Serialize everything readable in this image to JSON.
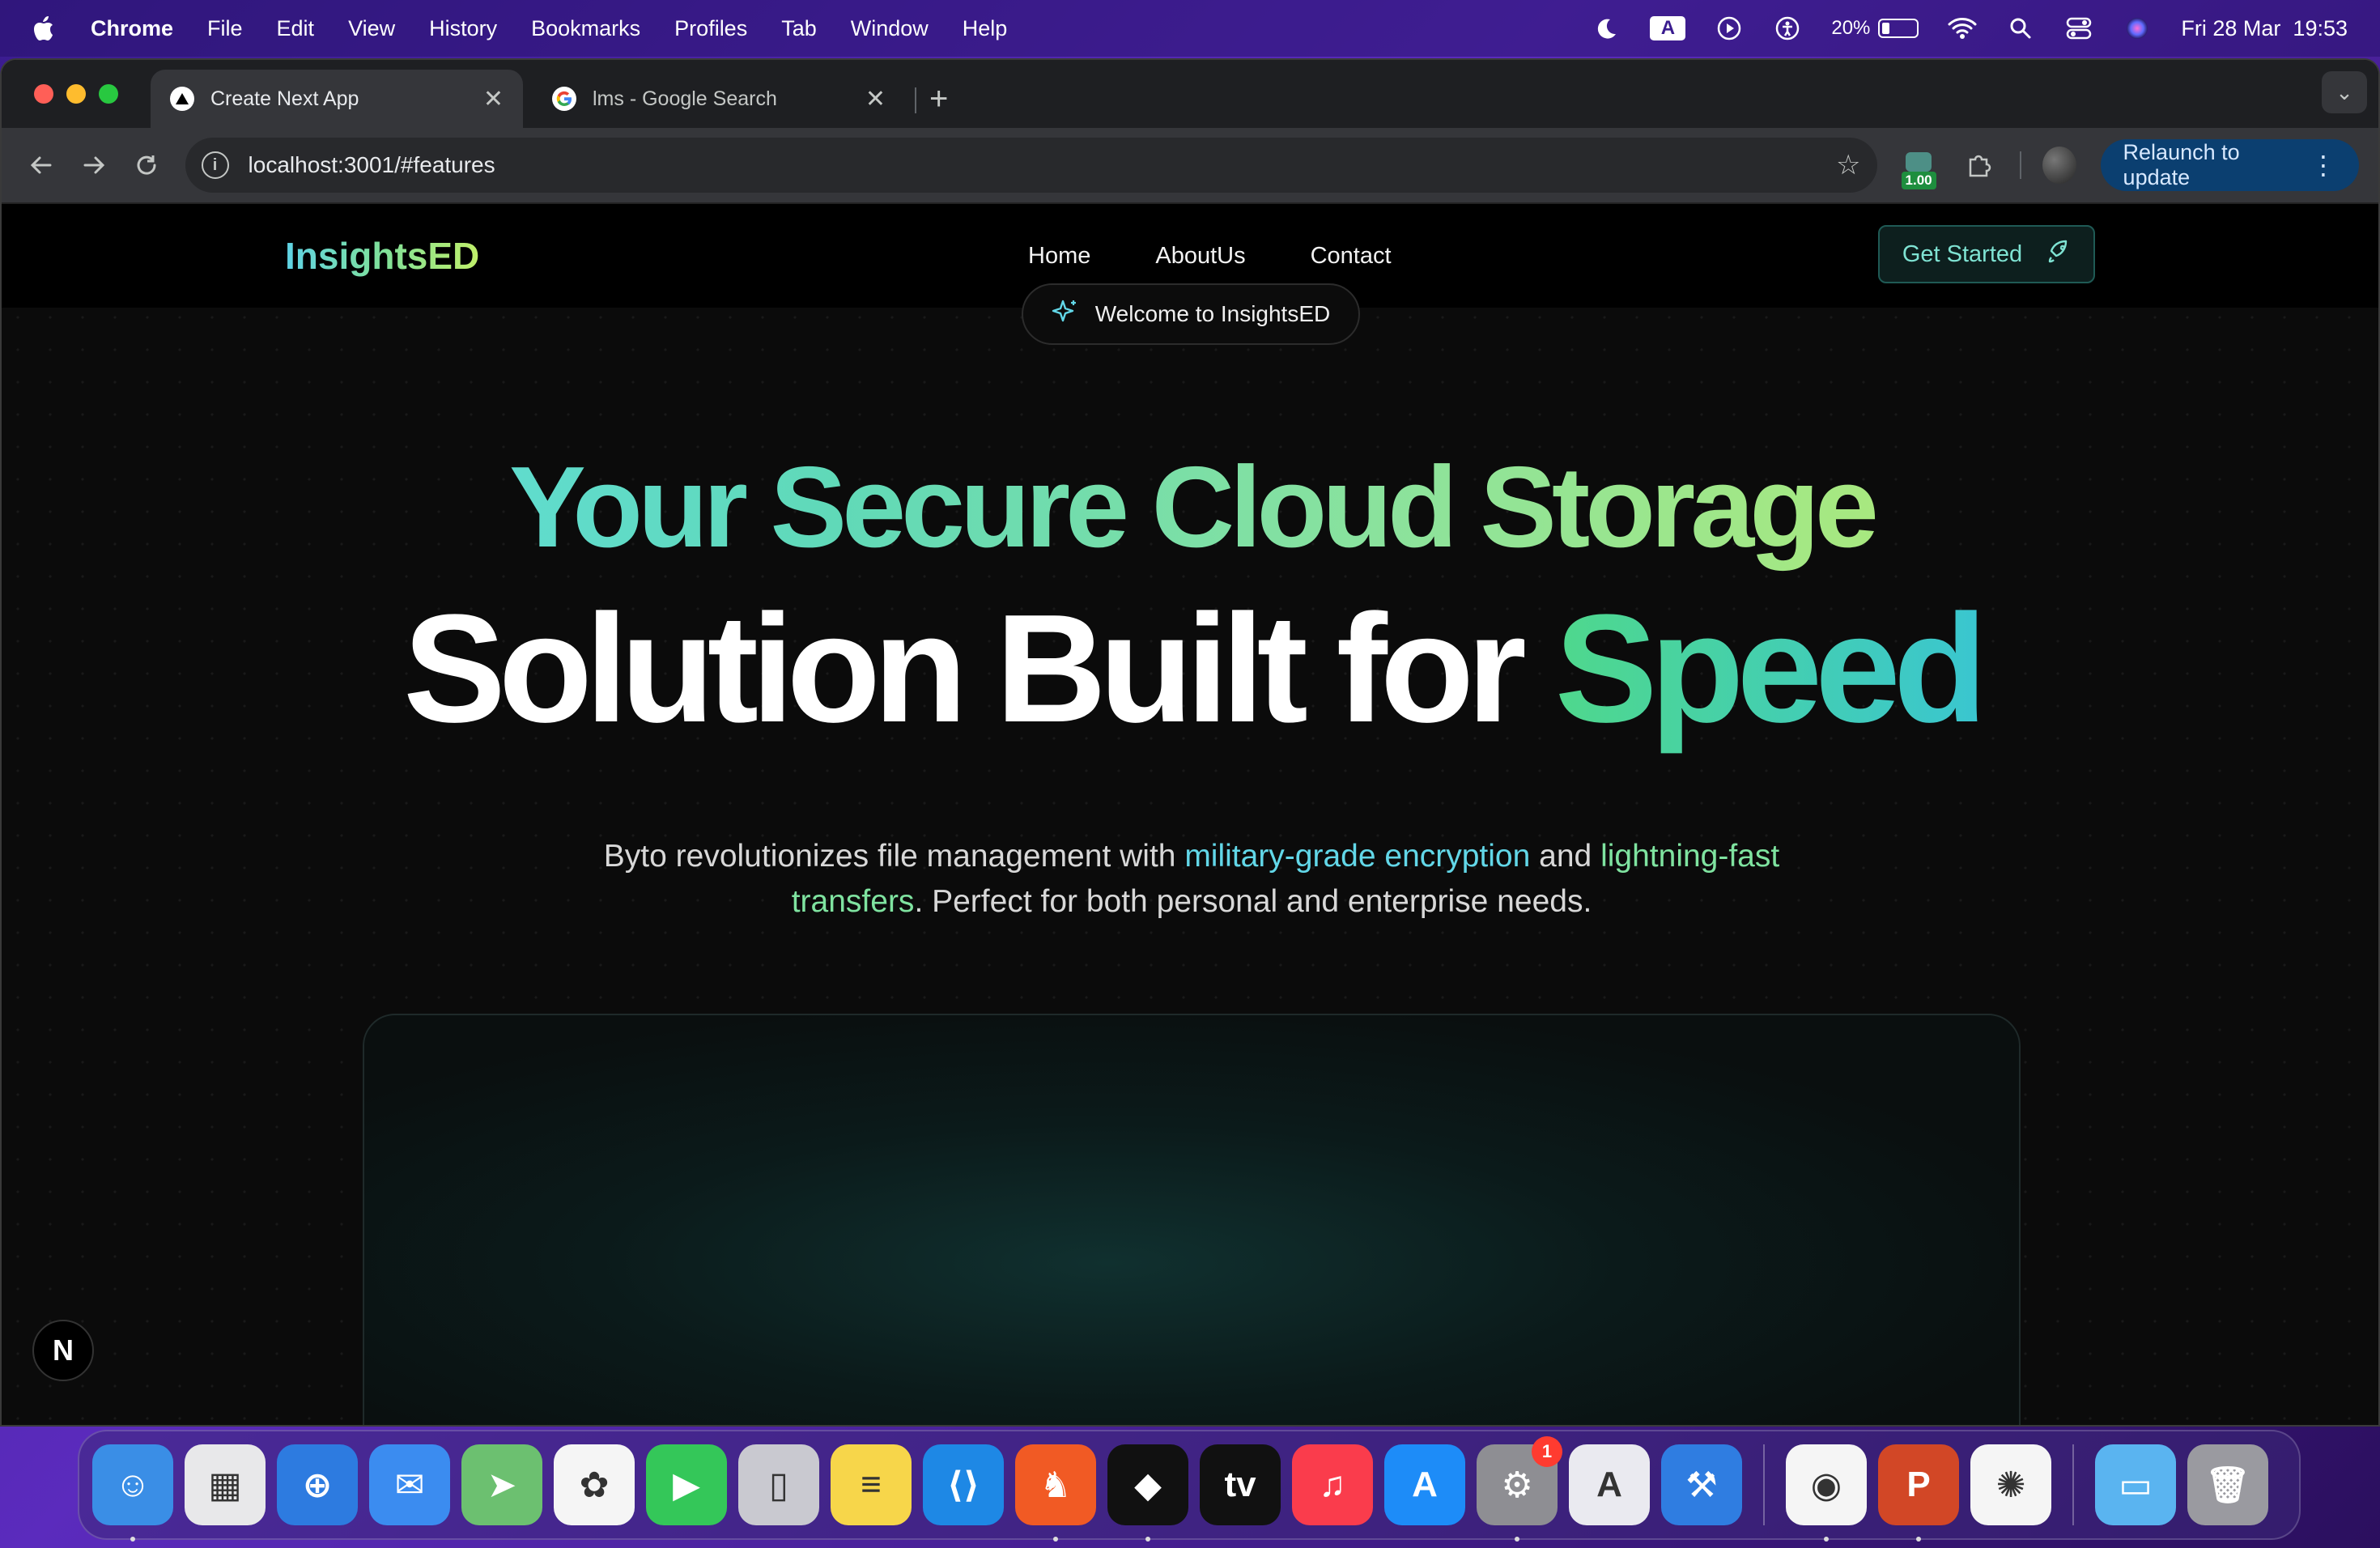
{
  "menubar": {
    "app": "Chrome",
    "items": [
      "File",
      "Edit",
      "View",
      "History",
      "Bookmarks",
      "Profiles",
      "Tab",
      "Window",
      "Help"
    ],
    "battery": "20%",
    "datetime": "Fri 28 Mar  19:53"
  },
  "browser": {
    "tabs": [
      {
        "title": "Create Next App",
        "active": true
      },
      {
        "title": "lms - Google Search",
        "active": false
      }
    ],
    "url": "localhost:3001/#features",
    "extension_badge": "1.00",
    "relaunch_label": "Relaunch to update"
  },
  "site": {
    "logo": "InsightsED",
    "nav": [
      "Home",
      "AboutUs",
      "Contact"
    ],
    "cta": "Get Started",
    "pill": "Welcome to InsightsED",
    "headline_line1": "Your Secure Cloud Storage",
    "headline_line2_plain": "Solution Built for ",
    "headline_line2_accent": "Speed",
    "desc_part1": "Byto revolutionizes file management with ",
    "desc_hl1": "military-grade encryption",
    "desc_part2": " and ",
    "desc_hl2": "lightning-fast transfers",
    "desc_part3": ". Perfect for both personal and enterprise needs.",
    "next_badge": "N"
  },
  "dock": {
    "apps": [
      {
        "name": "finder",
        "label": "☺",
        "color": "#3a8ee6",
        "running": true
      },
      {
        "name": "launchpad",
        "label": "▦",
        "color": "#e8e8ea",
        "running": false
      },
      {
        "name": "safari",
        "label": "⊕",
        "color": "#2d7be0",
        "running": false
      },
      {
        "name": "mail",
        "label": "✉",
        "color": "#3b8cf0",
        "running": false
      },
      {
        "name": "maps",
        "label": "➤",
        "color": "#6cc070",
        "running": false
      },
      {
        "name": "photos",
        "label": "✿",
        "color": "#f5f5f5",
        "running": false
      },
      {
        "name": "facetime",
        "label": "▶",
        "color": "#34c759",
        "running": false
      },
      {
        "name": "iphone-mirroring",
        "label": "▯",
        "color": "#c9c9d0",
        "running": false
      },
      {
        "name": "notes",
        "label": "≡",
        "color": "#f7d64a",
        "running": false
      },
      {
        "name": "vscode",
        "label": "⟨⟩",
        "color": "#1e88e5",
        "running": false
      },
      {
        "name": "brave",
        "label": "♞",
        "color": "#f15a24",
        "running": true
      },
      {
        "name": "unity",
        "label": "◆",
        "color": "#111111",
        "running": true
      },
      {
        "name": "apple-tv",
        "label": "tv",
        "color": "#111111",
        "running": false
      },
      {
        "name": "music",
        "label": "♫",
        "color": "#fa3c4c",
        "running": false
      },
      {
        "name": "app-store",
        "label": "A",
        "color": "#1d8cf8",
        "running": false
      },
      {
        "name": "system-settings",
        "label": "⚙",
        "color": "#8e8e93",
        "running": true,
        "badge": "1"
      },
      {
        "name": "instruments",
        "label": "A",
        "color": "#eaeaf0",
        "running": false
      },
      {
        "name": "xcode",
        "label": "⚒",
        "color": "#2f7de1",
        "running": false
      }
    ],
    "recent": [
      {
        "name": "chrome",
        "label": "◉",
        "color": "#f5f5f5",
        "running": true
      },
      {
        "name": "powerpoint",
        "label": "P",
        "color": "#d24726",
        "running": true
      },
      {
        "name": "chatgpt",
        "label": "✺",
        "color": "#f5f5f5",
        "running": false
      }
    ],
    "end": [
      {
        "name": "downloads-folder",
        "label": "▭",
        "color": "#5ab4f0",
        "running": false
      },
      {
        "name": "trash",
        "label": "🗑",
        "color": "#9a9aa0",
        "running": false
      }
    ]
  },
  "colors": {
    "accent_teal": "#62d7e8",
    "accent_green": "#7fe3a0",
    "relaunch_bg": "#0b3f70"
  }
}
